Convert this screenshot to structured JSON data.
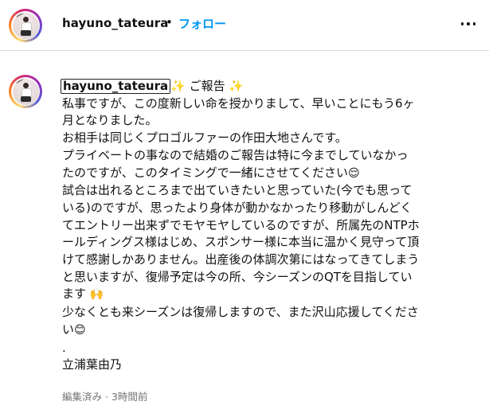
{
  "header": {
    "username": "hayuno_tateura",
    "separator": "•",
    "follow_label": "フォロー"
  },
  "caption": {
    "username": "hayuno_tateura",
    "lines": [
      "私事ですが、この度新しい命を授かりまして、早いことにもう6ヶ",
      "月となりました。",
      "お相手は同じくプロゴルファーの作田大地さんです。",
      "プライベートの事なので結婚のご報告は特に今までしていなかっ",
      "たのですが、このタイミングで一緒にさせてください",
      "試合は出れるところまで出ていきたいと思っていた(今でも思って",
      "いる)のですが、思ったより身体が動かなかったり移動がしんどく",
      "てエントリー出来ずでモヤモヤしているのですが、所属先のNTPホ",
      "ールディングス様はじめ、スポンサー様に本当に温かく見守って頂",
      "けて感謝しかありません。出産後の体調次第にはなってきてしまう",
      "と思いますが、復帰予定は今の所、今シーズンのQTを目指してい",
      "ます",
      "少なくとも来シーズンは復帰しますので、また沢山応援してくださ",
      "い",
      ".",
      "立浦葉由乃"
    ],
    "title_prefix": "✨",
    "title_text": " ご報告 ",
    "title_suffix": "✨",
    "emoji_relieved": "😌",
    "emoji_hands": "🙌",
    "emoji_smile": "😊"
  },
  "meta": {
    "text": "編集済み · 3時間前"
  },
  "icons": {
    "more": "more-options-icon",
    "sparkle": "sparkles-icon"
  },
  "colors": {
    "follow": "#0095f6",
    "meta": "#737373"
  }
}
